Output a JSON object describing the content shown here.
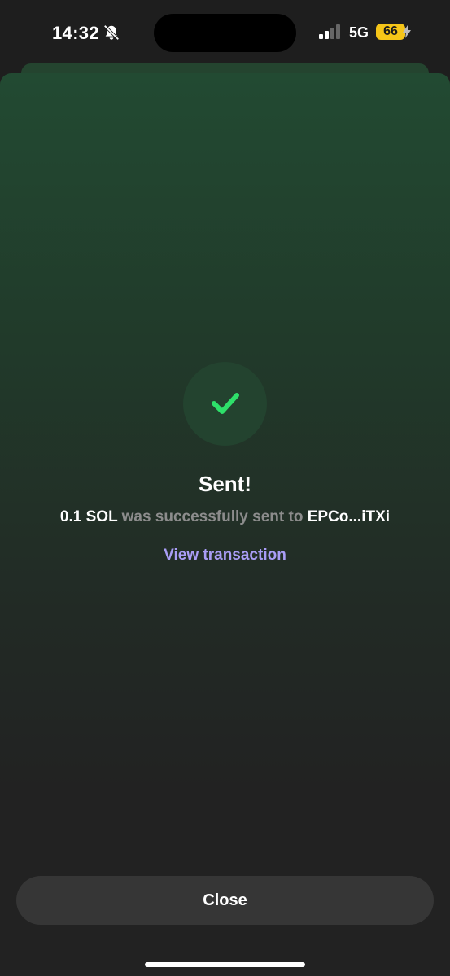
{
  "status_bar": {
    "time": "14:32",
    "network": "5G",
    "battery": "66",
    "icons": [
      "bell-slash-icon",
      "signal-icon",
      "bolt-icon"
    ]
  },
  "success": {
    "icon": "check-icon",
    "title": "Sent!",
    "amount": "0.1 SOL",
    "message_middle": " was successfully sent to ",
    "recipient": "EPCo...iTXi",
    "link_label": "View transaction"
  },
  "footer": {
    "close_label": "Close"
  },
  "colors": {
    "accent_green": "#2ee06a",
    "link_purple": "#a99df5",
    "battery_yellow": "#f5c518"
  }
}
